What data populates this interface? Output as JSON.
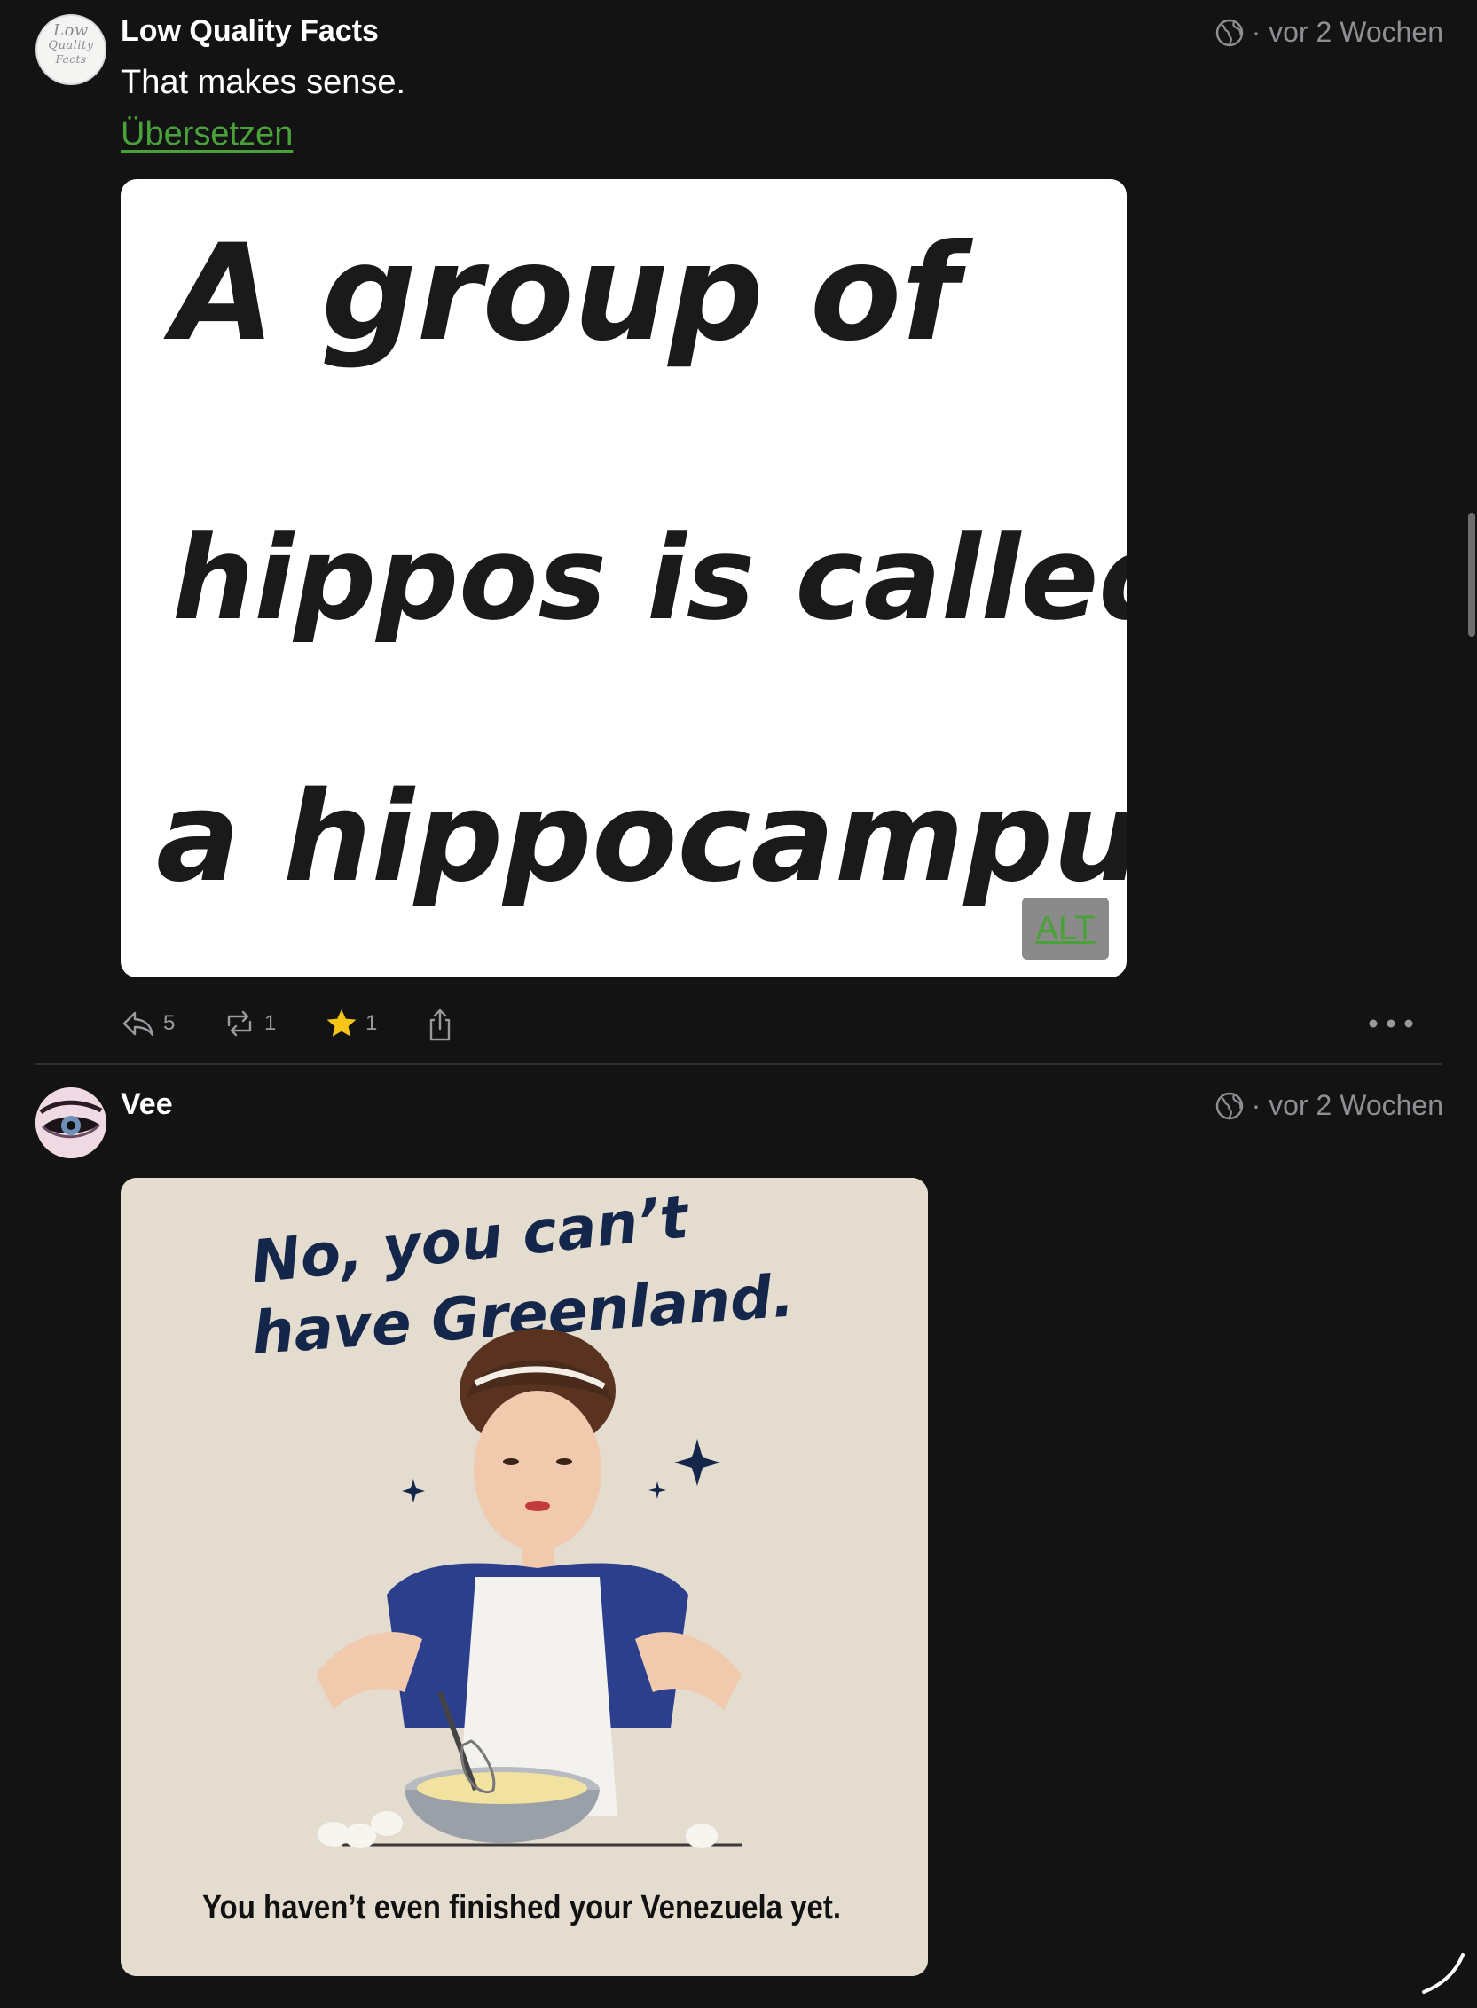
{
  "posts": [
    {
      "author": "Low Quality Facts",
      "avatar_text": [
        "Low",
        "Quality",
        "Facts"
      ],
      "visibility_icon": "globe-icon",
      "timestamp": "· vor 2 Wochen",
      "text": "That makes sense.",
      "translate_label": "Übersetzen",
      "image_text": [
        "A group of",
        "hippos is called",
        "a hippocampus."
      ],
      "alt_label": "ALT",
      "actions": {
        "reply_count": "5",
        "boost_count": "1",
        "favourite_count": "1"
      }
    },
    {
      "author": "Vee",
      "visibility_icon": "globe-icon",
      "timestamp": "· vor 2 Wochen",
      "image_headline": [
        "No, you can’t",
        "have Greenland."
      ],
      "image_caption": "You haven’t even finished your Venezuela yet."
    }
  ],
  "colors": {
    "background": "#131314",
    "link_green": "#4aa13a",
    "star_yellow": "#f5c518",
    "muted_text": "#8e8e93"
  }
}
